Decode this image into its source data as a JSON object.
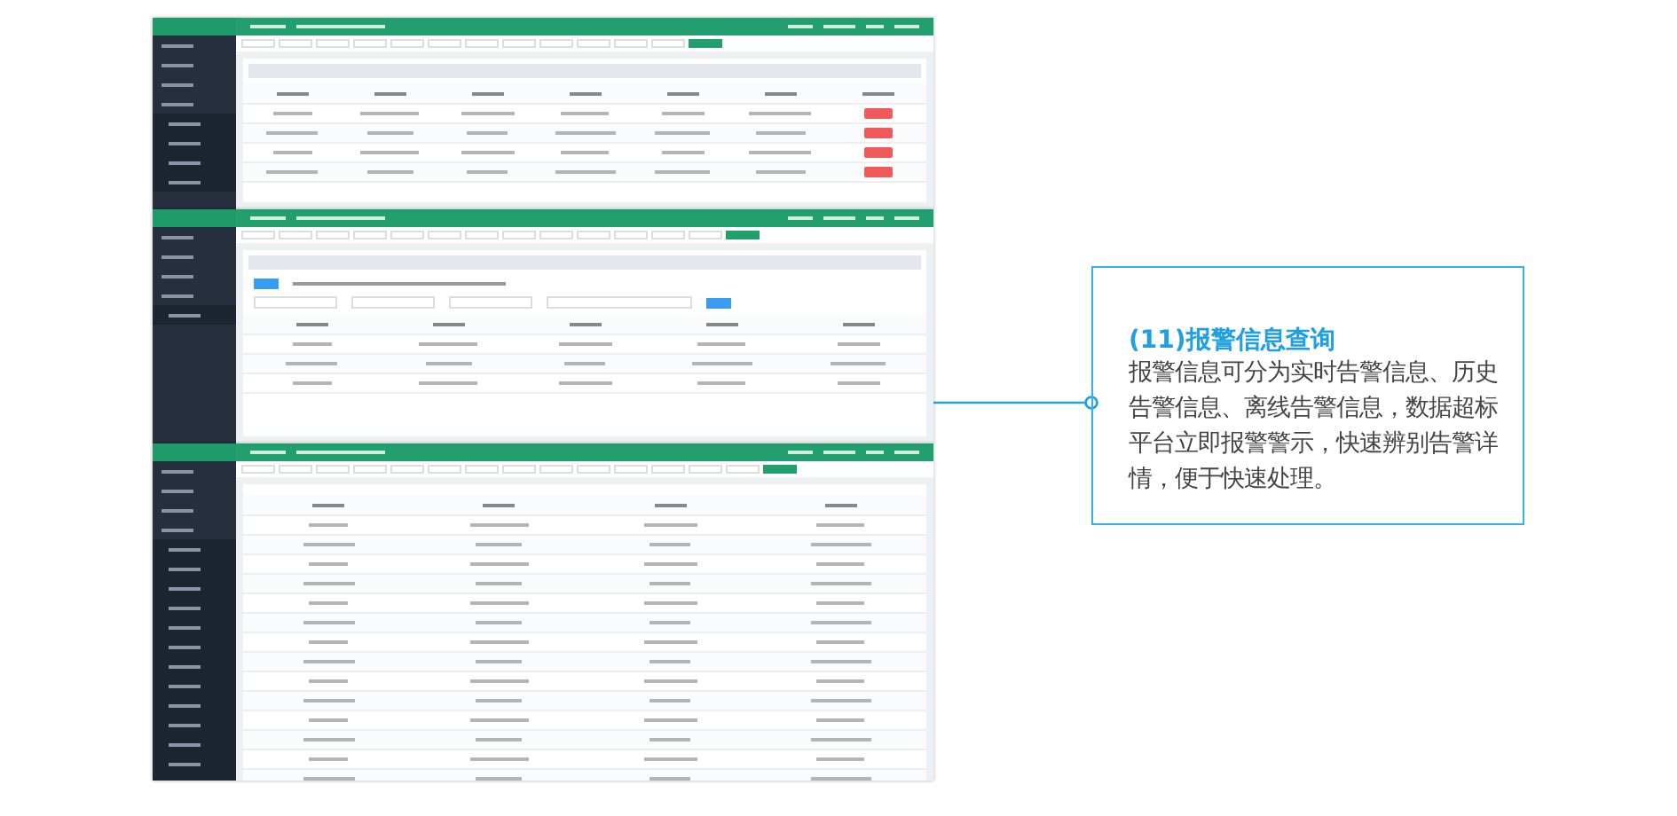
{
  "screenshots": [
    {
      "kind": "realtime"
    },
    {
      "kind": "history"
    },
    {
      "kind": "offline"
    }
  ],
  "callout": {
    "title": "(11)报警信息查询",
    "body": "报警信息可分为实时告警信息、历史告警信息、离线告警信息，数据超标平台立即报警警示，快速辨别告警详情，便于快速处理。"
  }
}
